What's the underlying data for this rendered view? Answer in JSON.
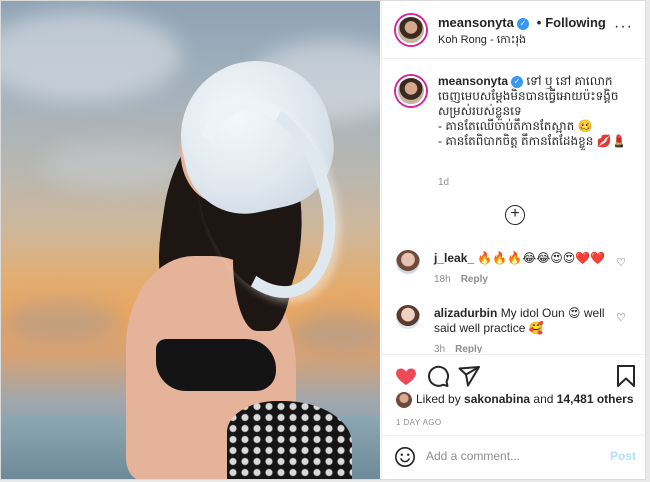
{
  "post": {
    "username": "meansonyta",
    "following": "Following",
    "separator": "•",
    "location": "Koh Rong - កោះរុង"
  },
  "caption": {
    "username": "meansonyta",
    "text": "ទៅ ឬ នៅ​ គាលោក ចេញមេបស​ម្ដែងមិនបានធ្វើអោយប៉ះទង្គិច សម្រស់របស់ខ្លួនទេ\n- គានតែឈើចាប់តឹកានតែស្អាត 🥴\n- គានតែពិបាកចិត្ត តឹកានតែដែងខ្លួន 💋💄",
    "time": "1d"
  },
  "comments": [
    {
      "username": "j_leak_",
      "text": "🔥🔥🔥😂😂😍😍❤️❤️",
      "time": "18h",
      "reply": "Reply"
    },
    {
      "username": "alizadurbin",
      "text": "My idol Oun 😍 well said well practice 🥰",
      "time": "3h",
      "reply": "Reply"
    }
  ],
  "likes": {
    "liked_by": "Liked by",
    "user": "sakonabina",
    "and": "and",
    "count": "14,481 others"
  },
  "post_age": "1 DAY AGO",
  "composer": {
    "placeholder": "Add a comment...",
    "post_label": "Post"
  },
  "colors": {
    "heart": "#ed4956",
    "verified": "#3897f0",
    "post_disabled": "#b2dffc"
  },
  "icons": [
    "verified-badge-icon",
    "more-options-icon",
    "add-comment-plus-icon",
    "heart-icon",
    "comment-icon",
    "share-icon",
    "bookmark-icon",
    "emoji-icon"
  ]
}
